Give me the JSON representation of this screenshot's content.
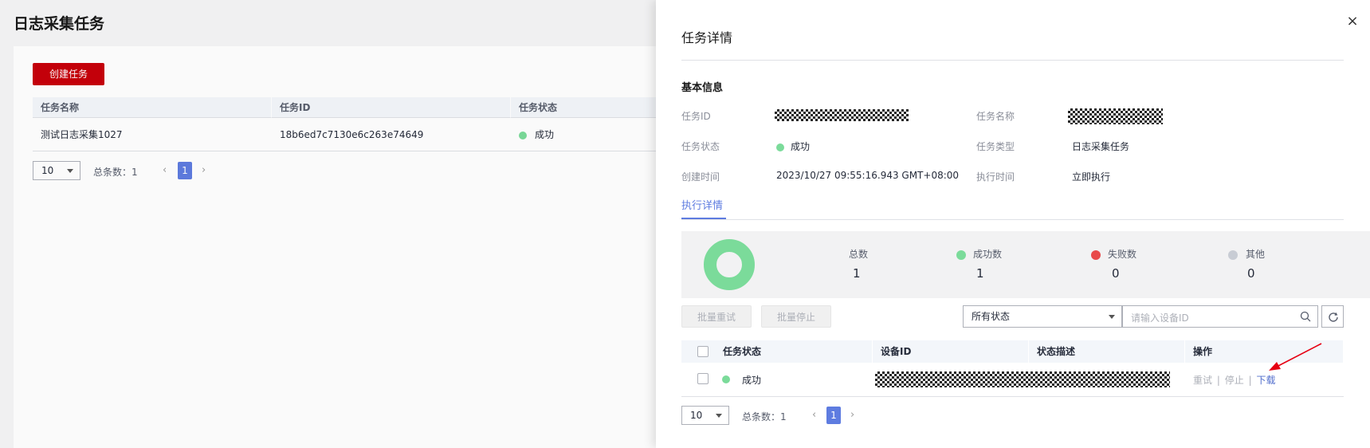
{
  "background": {
    "title": "日志采集任务",
    "create_button": "创建任务",
    "table": {
      "headers": [
        "任务名称",
        "任务ID",
        "任务状态"
      ],
      "rows": [
        {
          "name": "测试日志采集1027",
          "id": "18b6ed7c7130e6c263e74649",
          "status": "成功"
        }
      ]
    },
    "pagination": {
      "page_size": "10",
      "total_label": "总条数：",
      "total": "1",
      "current_page": "1"
    }
  },
  "drawer": {
    "title": "任务详情",
    "close_icon": "×",
    "basic_section": "基本信息",
    "fields": {
      "task_id_label": "任务ID",
      "task_name_label": "任务名称",
      "status_label": "任务状态",
      "status_value": "成功",
      "type_label": "任务类型",
      "type_value": "日志采集任务",
      "created_label": "创建时间",
      "created_value": "2023/10/27 09:55:16.943 GMT+08:00",
      "exec_label": "执行时间",
      "exec_value": "立即执行"
    },
    "tab": "执行详情",
    "stats": {
      "total_label": "总数",
      "total": "1",
      "success_label": "成功数",
      "success": "1",
      "failed_label": "失败数",
      "failed": "0",
      "other_label": "其他",
      "other": "0"
    },
    "toolbar": {
      "batch_retry": "批量重试",
      "batch_stop": "批量停止",
      "status_filter": "所有状态",
      "search_placeholder": "请输入设备ID"
    },
    "table": {
      "headers": [
        "任务状态",
        "设备ID",
        "状态描述",
        "操作"
      ],
      "rows": [
        {
          "status": "成功",
          "actions": {
            "retry": "重试",
            "stop": "停止",
            "download": "下载",
            "separator": "|"
          }
        }
      ]
    },
    "pagination": {
      "page_size": "10",
      "total_label": "总条数：",
      "total": "1",
      "current_page": "1"
    }
  },
  "colors": {
    "accent": "#5e7ce0",
    "success": "#7bdb9a",
    "failed": "#e84a4a",
    "other": "#c8ccd4",
    "brand_red": "#c7000b"
  }
}
